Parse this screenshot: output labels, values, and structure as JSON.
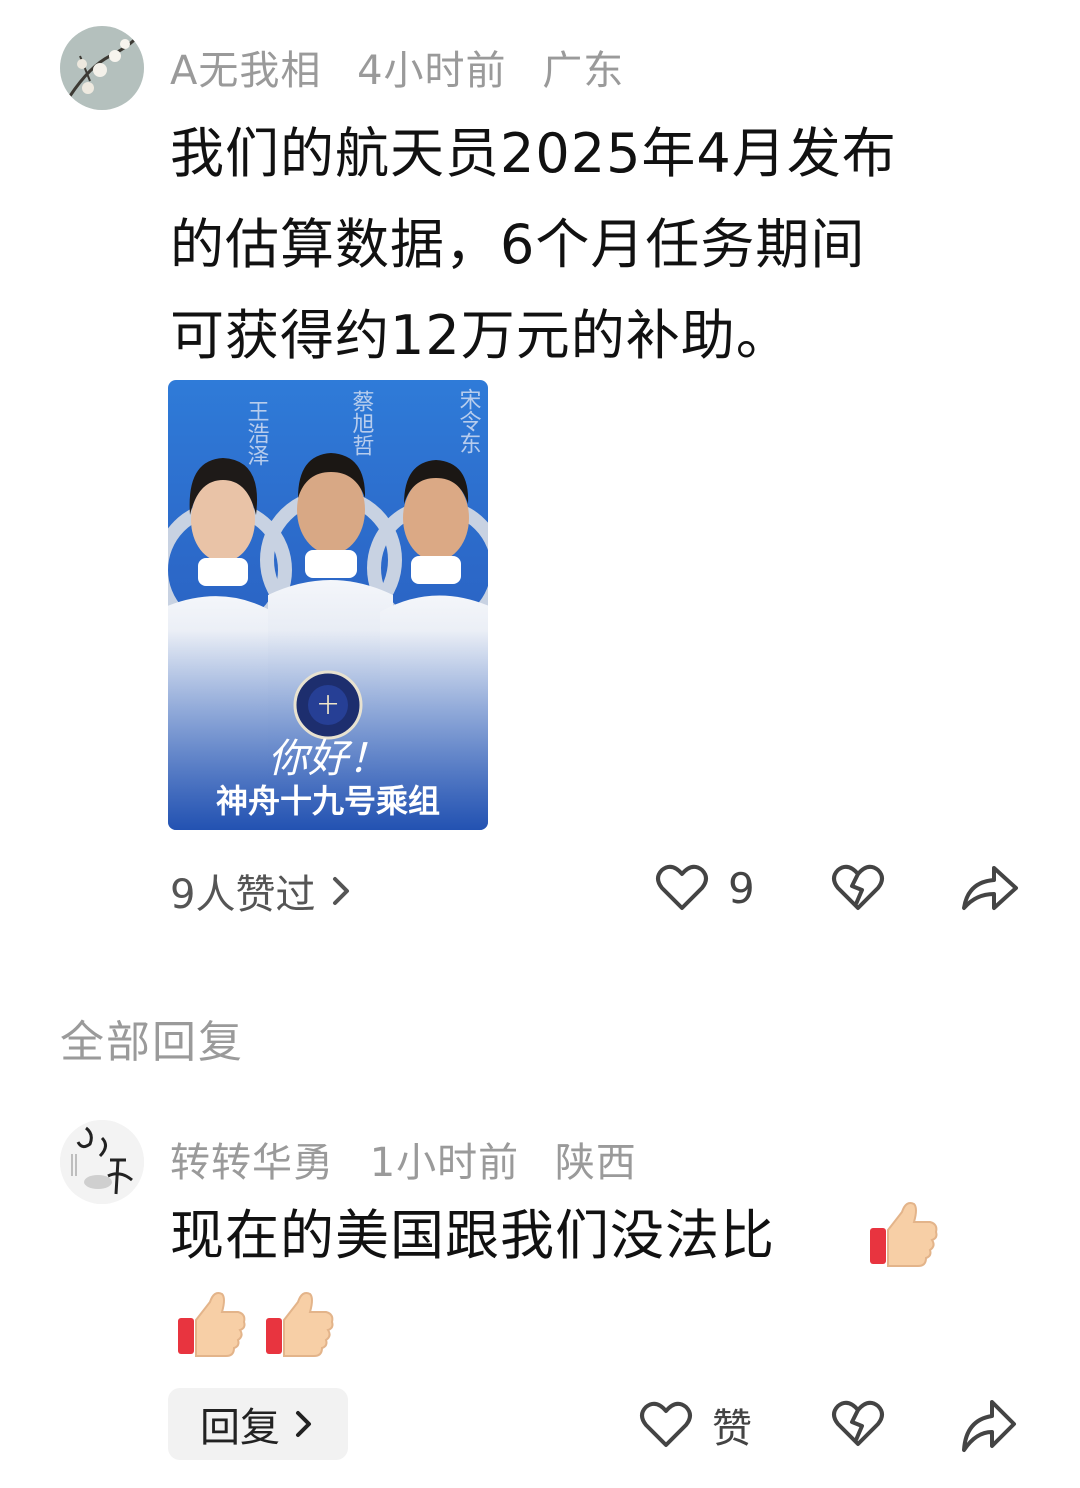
{
  "comment": {
    "username": "A无我相",
    "time": "4小时前",
    "location": "广东",
    "text_lines": [
      "我们的航天员2025年4月发布",
      "的估算数据，6个月任务期间",
      "可获得约12万元的补助。"
    ],
    "image": {
      "names": [
        "王浩泽",
        "蔡旭哲",
        "宋令东"
      ],
      "greeting": "你好！",
      "caption": "神舟十九号乘组"
    },
    "likes_link": "9人赞过",
    "like_count": "9"
  },
  "replies_header": "全部回复",
  "reply": {
    "username": "转转华勇",
    "time": "1小时前",
    "location": "陕西",
    "text": "现在的美国跟我们没法比",
    "emoji": [
      "thumbs-up",
      "thumbs-up",
      "thumbs-up"
    ],
    "reply_button": "回复",
    "like_label": "赞"
  },
  "icons": [
    "heart-icon",
    "broken-heart-icon",
    "share-icon",
    "chevron-right-icon"
  ]
}
